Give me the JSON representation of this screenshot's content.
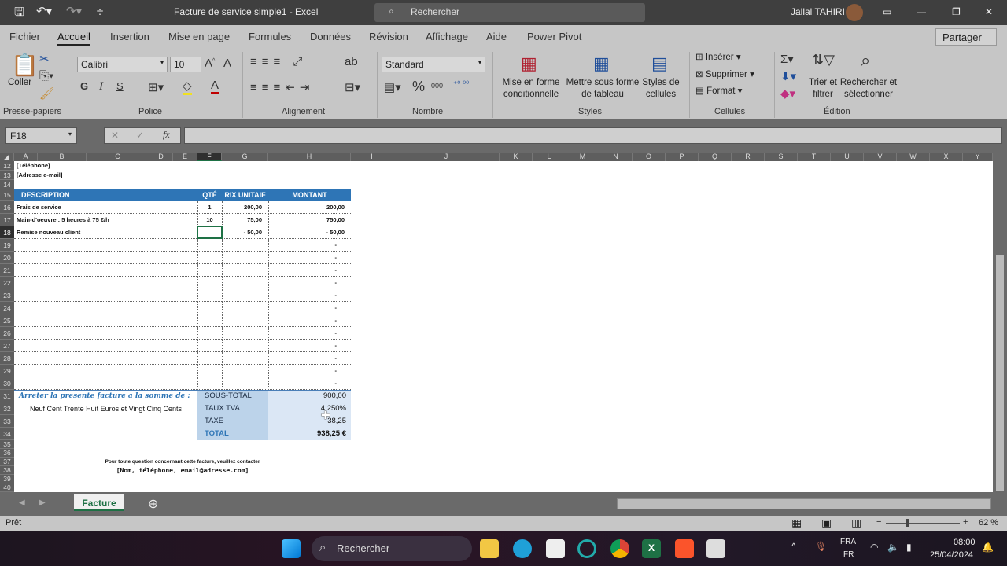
{
  "titlebar": {
    "doc_title": "Facture de service simple1  -  Excel",
    "search": "Rechercher",
    "user": "Jallal TAHIRI"
  },
  "tabs": [
    "Fichier",
    "Accueil",
    "Insertion",
    "Mise en page",
    "Formules",
    "Données",
    "Révision",
    "Affichage",
    "Aide",
    "Power Pivot"
  ],
  "active_tab": "Accueil",
  "share": "Partager",
  "ribbon": {
    "clipboard": {
      "paste": "Coller",
      "group": "Presse-papiers"
    },
    "font": {
      "name": "Calibri",
      "size": "10",
      "bold": "G",
      "italic": "I",
      "underline": "S",
      "group": "Police"
    },
    "alignment": {
      "group": "Alignement"
    },
    "number": {
      "format": "Standard",
      "group": "Nombre"
    },
    "styles": {
      "conditional": "Mise en forme conditionnelle",
      "table": "Mettre sous forme de tableau",
      "cell_styles": "Styles de cellules",
      "group": "Styles"
    },
    "cells": {
      "insert": "Insérer",
      "delete": "Supprimer",
      "format": "Format",
      "group": "Cellules"
    },
    "editing": {
      "sort": "Trier et filtrer",
      "find": "Rechercher et sélectionner",
      "group": "Édition"
    }
  },
  "formula_bar": {
    "name_box": "F18",
    "formula": ""
  },
  "columns": [
    "A",
    "B",
    "C",
    "D",
    "E",
    "F",
    "G",
    "H",
    "I",
    "J",
    "K",
    "L",
    "M",
    "N",
    "O",
    "P",
    "Q",
    "R",
    "S",
    "T",
    "U",
    "V",
    "W",
    "X",
    "Y"
  ],
  "selected_column": "F",
  "selected_row": 18,
  "sheet": {
    "phone": "[Téléphone]",
    "email": "[Adresse e-mail]",
    "headers": {
      "description": "DESCRIPTION",
      "qty": "QTÉ",
      "unit_price": "RIX UNITAIF",
      "amount": "MONTANT"
    },
    "items": [
      {
        "row": 16,
        "description": "Frais de service",
        "qty": "1",
        "unit_price": "200,00",
        "amount": "200,00"
      },
      {
        "row": 17,
        "description": "Main-d'oeuvre : 5 heures à 75 €/h",
        "qty": "10",
        "unit_price": "75,00",
        "amount": "750,00"
      },
      {
        "row": 18,
        "description": "Remise nouveau client",
        "qty": "",
        "unit_price": "-      50,00",
        "amount": "-                 50,00"
      }
    ],
    "empty_amount": "-",
    "amount_words_label": "Arreter la presente facture a la somme de :",
    "amount_words": "Neuf Cent Trente Huit Euros et Vingt Cinq Cents",
    "totals": [
      {
        "label": "SOUS-TOTAL",
        "value": "900,00"
      },
      {
        "label": "TAUX TVA",
        "value": "4,250%"
      },
      {
        "label": "TAXE",
        "value": "38,25"
      },
      {
        "label": "TOTAL",
        "value": "938,25 €"
      }
    ],
    "footer1": "Pour toute question concernant cette facture, veuillez contacter",
    "footer2": "[Nom, téléphone, email@adresse.com]"
  },
  "sheet_tab": "Facture",
  "status": {
    "ready": "Prêt",
    "zoom": "62 %"
  },
  "taskbar": {
    "search": "Rechercher",
    "lang1": "FRA",
    "lang2": "FR",
    "time": "08:00",
    "date": "25/04/2024"
  },
  "colors": {
    "header_blue": "#2e75b6",
    "totals_dark": "#bcd3ea",
    "totals_light": "#dbe7f5",
    "excel_green": "#1e7145"
  }
}
